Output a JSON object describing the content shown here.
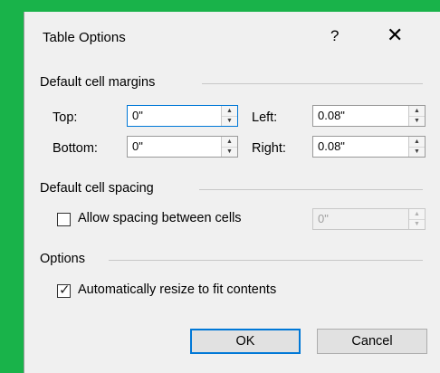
{
  "dialog": {
    "title": "Table Options",
    "help_label": "?",
    "close_label": "✕"
  },
  "margins": {
    "section_label": "Default cell margins",
    "top": {
      "label": "Top:",
      "value": "0\""
    },
    "bottom": {
      "label": "Bottom:",
      "value": "0\""
    },
    "left": {
      "label": "Left:",
      "value": "0.08\""
    },
    "right": {
      "label": "Right:",
      "value": "0.08\""
    }
  },
  "spacing": {
    "section_label": "Default cell spacing",
    "allow_label": "Allow spacing between cells",
    "allow_checked": false,
    "value": "0\""
  },
  "options": {
    "section_label": "Options",
    "autoresize_label": "Automatically resize to fit contents",
    "autoresize_checked": true
  },
  "buttons": {
    "ok": "OK",
    "cancel": "Cancel"
  },
  "colors": {
    "frame": "#19b34a",
    "accent": "#0078d7"
  }
}
